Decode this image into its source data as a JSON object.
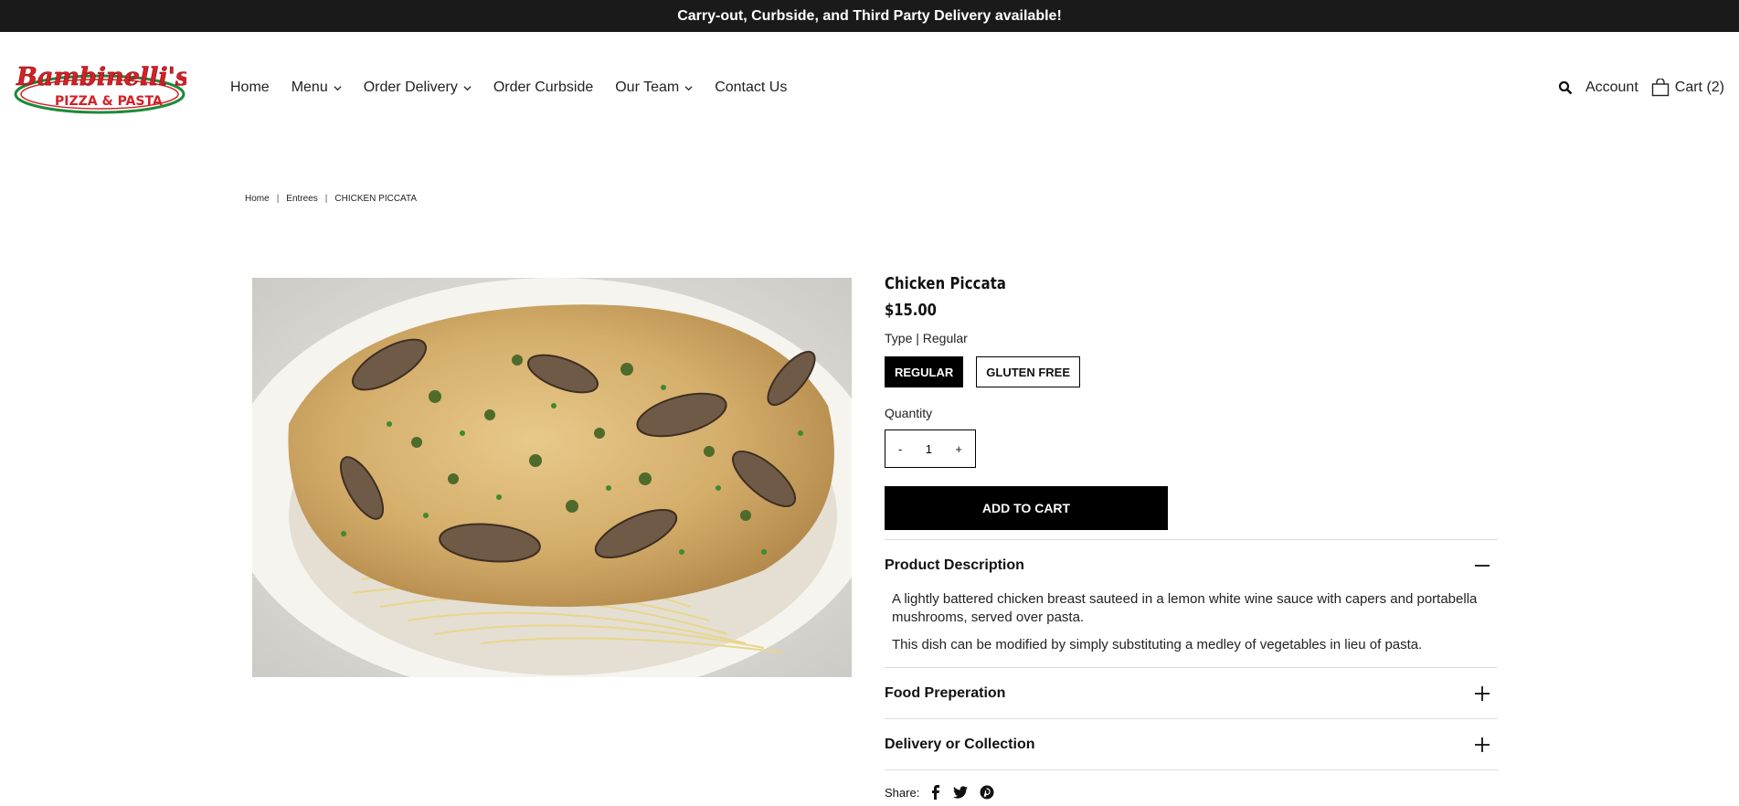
{
  "announcement": "Carry-out, Curbside, and Third Party Delivery available!",
  "logo": {
    "line1": "Bambinelli's",
    "line2": "PIZZA & PASTA"
  },
  "nav": [
    {
      "label": "Home",
      "dropdown": false
    },
    {
      "label": "Menu",
      "dropdown": true
    },
    {
      "label": "Order Delivery",
      "dropdown": true
    },
    {
      "label": "Order Curbside",
      "dropdown": false
    },
    {
      "label": "Our Team",
      "dropdown": true
    },
    {
      "label": "Contact Us",
      "dropdown": false
    }
  ],
  "header": {
    "account": "Account",
    "cart": "Cart (2)"
  },
  "breadcrumb": {
    "home": "Home",
    "category": "Entrees",
    "current": "CHICKEN PICCATA"
  },
  "product": {
    "title": "Chicken Piccata",
    "price": "$15.00",
    "variant_label": "Type | Regular",
    "swatches": [
      "REGULAR",
      "GLUTEN FREE"
    ],
    "quantity_label": "Quantity",
    "quantity": "1",
    "minus": "-",
    "plus": "+",
    "add_to_cart": "ADD TO CART"
  },
  "accordion": {
    "description_title": "Product Description",
    "description_p1": "A lightly battered chicken breast sauteed in a lemon white wine sauce with capers and portabella mushrooms, served over pasta.",
    "description_p2": "This dish can be modified by simply substituting a medley of vegetables in lieu of pasta.",
    "prep_title": "Food Preperation",
    "delivery_title": "Delivery or Collection"
  },
  "share_label": "Share:",
  "colors": {
    "announce_bg": "#1a1a1a",
    "logo_red": "#d42027",
    "logo_green": "#1e8a3a"
  }
}
